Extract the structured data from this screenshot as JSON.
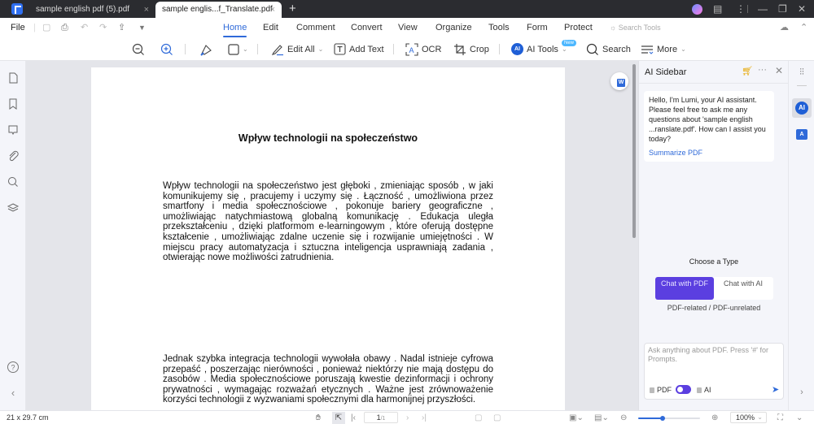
{
  "titlebar": {
    "tabs": [
      {
        "label": "sample english pdf (5).pdf",
        "active": false
      },
      {
        "label": "sample  englis...f_Translate.pdf",
        "active": true
      }
    ],
    "close_glyph": "×",
    "new_tab_glyph": "+",
    "window_controls": {
      "feedback": "▤",
      "more": "⋮",
      "minimize": "—",
      "restore": "❐",
      "close": "✕"
    }
  },
  "menubar": {
    "file_label": "File",
    "quick_access": [
      "save-icon",
      "print-icon",
      "undo-icon",
      "redo-icon",
      "share-icon",
      "customize-icon"
    ],
    "tabs": [
      {
        "label": "Home",
        "active": true
      },
      {
        "label": "Edit",
        "active": false
      },
      {
        "label": "Comment",
        "active": false
      },
      {
        "label": "Convert",
        "active": false
      },
      {
        "label": "View",
        "active": false
      },
      {
        "label": "Organize",
        "active": false
      },
      {
        "label": "Tools",
        "active": false
      },
      {
        "label": "Form",
        "active": false
      },
      {
        "label": "Protect",
        "active": false
      }
    ],
    "search_tools_label": "Search Tools"
  },
  "toolbar": {
    "edit_all": "Edit All",
    "add_text": "Add Text",
    "ocr": "OCR",
    "crop": "Crop",
    "ai_tools": "AI Tools",
    "ai_tools_badge": "New",
    "search": "Search",
    "more": "More"
  },
  "document": {
    "title": "Wpływ technologii na społeczeństwo",
    "paragraphs": [
      "Wpływ technologii  na społeczeństwo  jest głęboki , zmieniając  sposób , w jaki komunikujemy  się , pracujemy  i uczymy  się . Łączność , umożliwiona  przez smartfony  i media  społecznościowe  , pokonuje  bariery  geograficzne  , umożliwiając  natychmiastową  globalną  komunikację  . Edukacja  uległa przekształceniu , dzięki platformom  e-learningowym , które oferują dostępne kształcenie , umożliwiając  zdalne  uczenie  się i rozwijanie  umiejętności  . W miejscu  pracy  automatyzacja  i sztuczna  inteligencja  usprawniają  zadania , otwierając nowe możliwości zatrudnienia.",
      "Jednak szybka integracja technologii wywołała obawy . Nadal istnieje cyfrowa przepaść , poszerzając  nierówności , ponieważ  niektórzy  nie mają dostępu  do zasobów . Media społecznościowe  poruszają kwestie dezinformacji  i ochrony prywatności  , wymagając  rozważań  etycznych . Ważne  jest  zrównoważenie korzyści technologii z wyzwaniami społecznymi dla harmonijnej przyszłości."
    ]
  },
  "ai_sidebar": {
    "title": "AI Sidebar",
    "greeting": "Hello, I'm Lumi, your AI assistant. Please feel free to ask me any questions about 'sample english ...ranslate.pdf'. How can I assist you today?",
    "summarize_link": "Summarize PDF",
    "choose_type_label": "Choose a Type",
    "type_options": [
      {
        "label": "Chat with PDF",
        "selected": true
      },
      {
        "label": "Chat with AI",
        "selected": false
      }
    ],
    "type_subtitle": "PDF-related / PDF-unrelated",
    "chat_placeholder": "Ask anything about PDF. Press '#' for Prompts.",
    "chat_value": "",
    "mode_pdf_label": "PDF",
    "mode_ai_label": "AI",
    "mode_toggle_on": true,
    "accent_color": "#5b3fe0"
  },
  "statusbar": {
    "page_size": "21 x 29.7 cm",
    "current_page": "1",
    "total_pages": "/1",
    "zoom_level": "100%",
    "zoom_fraction": 0.4
  },
  "colors": {
    "brand_blue": "#2f6ad9",
    "titlebar_bg": "#2b2c30",
    "cart_icon": "#e6a700"
  }
}
